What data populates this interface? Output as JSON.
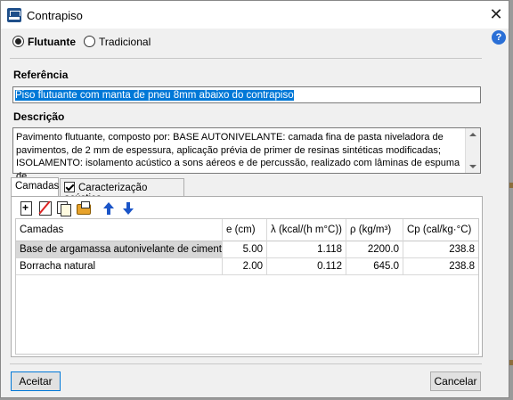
{
  "window": {
    "title": "Contrapiso",
    "app_icon": "cype-app-icon"
  },
  "options": {
    "selected": "Flutuante",
    "items": [
      "Flutuante",
      "Tradicional"
    ]
  },
  "referencia": {
    "label": "Referência",
    "value": "Piso flutuante com manta de pneu 8mm abaixo do contrapiso"
  },
  "descricao": {
    "label": "Descrição",
    "text": "Pavimento flutuante, composto por: BASE AUTONIVELANTE: camada fina de pasta niveladora de\npavimentos, de 2 mm de espessura, aplicação prévia de primer de resinas sintéticas modificadas;\nISOLAMENTO: isolamento acústico a sons aéreos e de percussão, realizado com lâminas de espuma de"
  },
  "tabs": [
    {
      "label": "Camadas",
      "active": true
    },
    {
      "label": "Caracterização acústica",
      "checked": true
    }
  ],
  "toolbar": [
    "new-layer-icon",
    "delete-layer-icon",
    "copy-layer-icon",
    "edit-layer-icon",
    "move-up-icon",
    "move-down-icon"
  ],
  "table": {
    "headers": [
      "Camadas",
      "e (cm)",
      "λ (kcal/(h m°C))",
      "ρ (kg/m³)",
      "Cp (cal/kg·°C)"
    ],
    "rows": [
      [
        "Base de argamassa autonivelante de cimento",
        "5.00",
        "1.118",
        "2200.0",
        "238.8"
      ],
      [
        "Borracha natural",
        "2.00",
        "0.112",
        "645.0",
        "238.8"
      ]
    ]
  },
  "buttons": {
    "ok": "Aceitar",
    "cancel": "Cancelar"
  }
}
